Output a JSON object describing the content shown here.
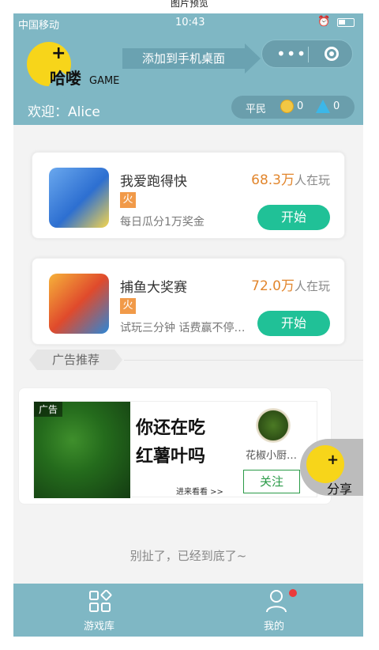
{
  "window": {
    "title": "图片预览"
  },
  "status_bar": {
    "carrier": "中国移动",
    "time": "10:43"
  },
  "header": {
    "logo_text": "哈喽",
    "logo_game": "GAME",
    "add_to_desktop": "添加到手机桌面",
    "welcome": "欢迎：Alice",
    "rank": "平民",
    "coins": "0",
    "gems": "0"
  },
  "games": [
    {
      "title": "我爱跑得快",
      "hot": "火",
      "desc": "每日瓜分1万奖金",
      "players_num": "68.3万",
      "players_suffix": "人在玩",
      "start": "开始",
      "icon": "poker-game-icon"
    },
    {
      "title": "捕鱼大奖赛",
      "hot": "火",
      "desc": "试玩三分钟 话费赢不停…",
      "players_num": "72.0万",
      "players_suffix": "人在玩",
      "start": "开始",
      "icon": "shark-fishing-game-icon"
    }
  ],
  "ad_section": {
    "label": "广告推荐",
    "ad_tag": "广告",
    "headline_line1": "你还在吃",
    "headline_line2": "红薯叶吗",
    "sub": "进来看看 >>",
    "shop_name": "花椒小厨…",
    "follow": "关注"
  },
  "share": {
    "label": "分享"
  },
  "footer_text": "别扯了，已经到底了~",
  "tabbar": {
    "tab1": "游戏库",
    "tab2": "我的"
  },
  "colors": {
    "header": "#7fb7c4",
    "start_button": "#20c197",
    "hot_badge": "#f19a49",
    "player_count": "#e2862d"
  }
}
